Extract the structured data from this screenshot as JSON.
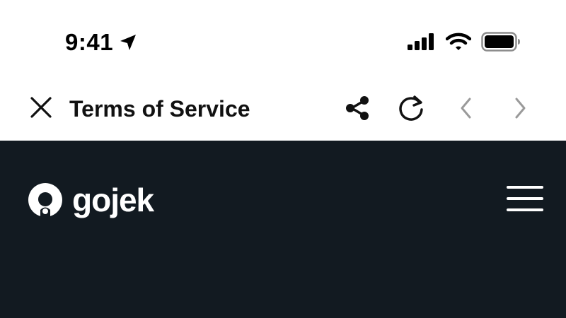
{
  "status_bar": {
    "time": "9:41",
    "icons": {
      "location": "location-arrow-icon",
      "signal": "cellular-signal-icon",
      "wifi": "wifi-icon",
      "battery": "battery-icon"
    }
  },
  "toolbar": {
    "title": "Terms of Service",
    "icons": {
      "close": "close-icon",
      "share": "share-icon",
      "reload": "reload-icon",
      "back": "chevron-left-icon",
      "forward": "chevron-right-icon"
    }
  },
  "web": {
    "logo_text": "gojek",
    "icons": {
      "logo": "gojek-logo-icon",
      "menu": "hamburger-menu-icon"
    }
  },
  "colors": {
    "web_background": "#121a21",
    "toolbar_background": "#ffffff",
    "disabled_nav": "#9a9a9a"
  }
}
